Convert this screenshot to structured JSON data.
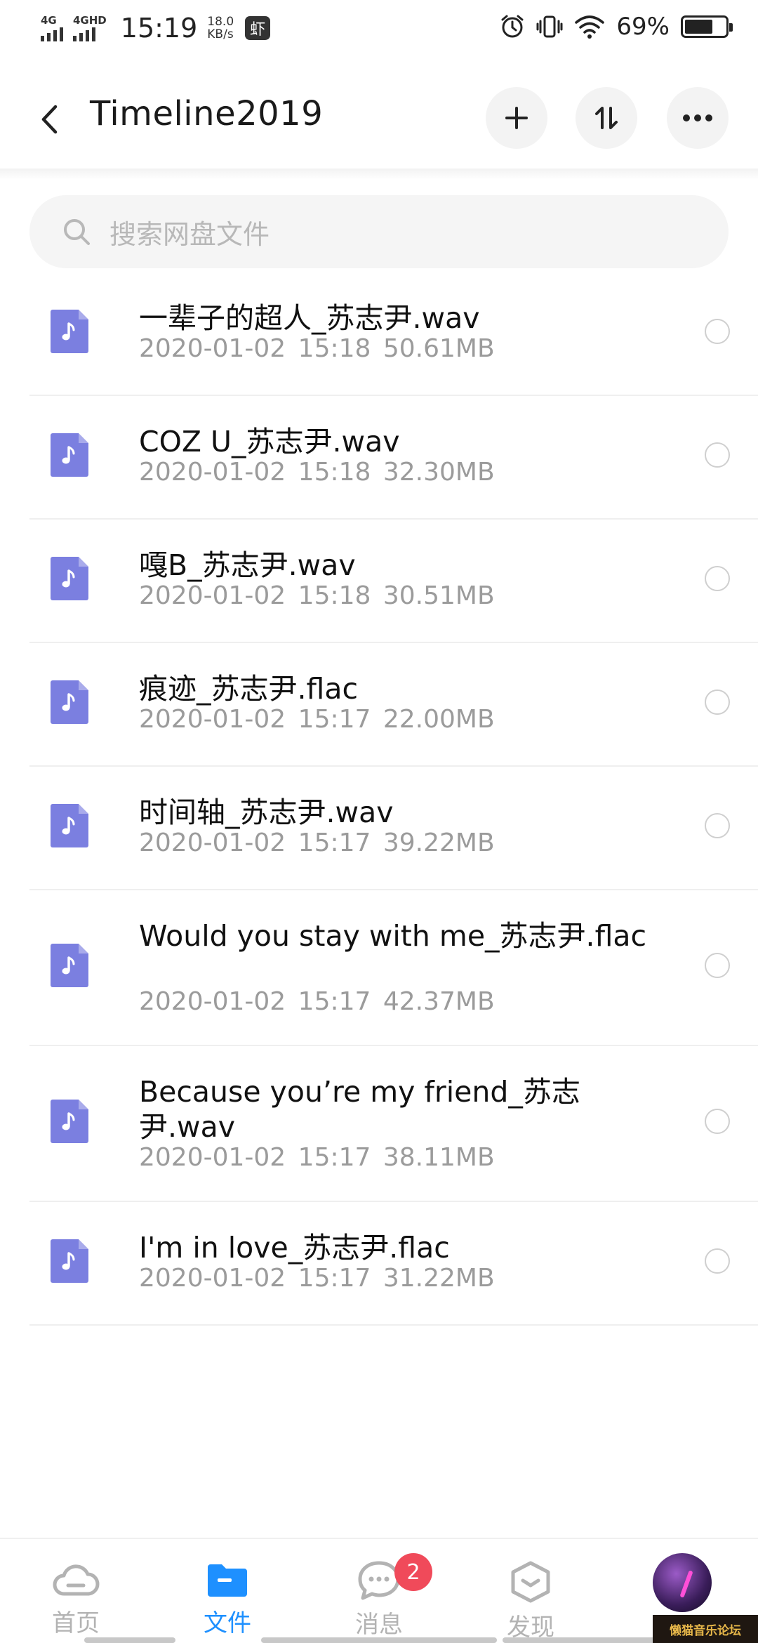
{
  "status_bar": {
    "signal1_label": "4G",
    "signal2_label": "4GHD",
    "time": "15:19",
    "speed_value": "18.0",
    "speed_unit": "KB/s",
    "app_glyph": "虾",
    "battery_percent": "69%",
    "battery_level": 0.69
  },
  "header": {
    "title": "Timeline2019",
    "icons": [
      "back-chevron-icon",
      "plus-icon",
      "sort-icon",
      "more-icon"
    ]
  },
  "search": {
    "placeholder": "搜索网盘文件"
  },
  "files": [
    {
      "name": "一辈子的超人_苏志尹.wav",
      "date": "2020-01-02",
      "time": "15:18",
      "size": "50.61MB"
    },
    {
      "name": "COZ U_苏志尹.wav",
      "date": "2020-01-02",
      "time": "15:18",
      "size": "32.30MB"
    },
    {
      "name": "嘎B_苏志尹.wav",
      "date": "2020-01-02",
      "time": "15:18",
      "size": "30.51MB"
    },
    {
      "name": "痕迹_苏志尹.flac",
      "date": "2020-01-02",
      "time": "15:17",
      "size": "22.00MB"
    },
    {
      "name": "时间轴_苏志尹.wav",
      "date": "2020-01-02",
      "time": "15:17",
      "size": "39.22MB"
    },
    {
      "name": "Would you stay with me_苏志尹.flac",
      "date": "2020-01-02",
      "time": "15:17",
      "size": "42.37MB"
    },
    {
      "name": "Because you’re my friend_苏志尹.wav",
      "date": "2020-01-02",
      "time": "15:17",
      "size": "38.11MB"
    },
    {
      "name": "I'm in love_苏志尹.flac",
      "date": "2020-01-02",
      "time": "15:17",
      "size": "31.22MB"
    }
  ],
  "bottom_nav": {
    "items": [
      {
        "label": "首页",
        "icon": "cloud-icon",
        "active": false
      },
      {
        "label": "文件",
        "icon": "folder-icon",
        "active": true
      },
      {
        "label": "消息",
        "icon": "chat-bubble-icon",
        "active": false,
        "badge": "2"
      },
      {
        "label": "发现",
        "icon": "discover-icon",
        "active": false
      },
      {
        "label": "",
        "icon": "avatar",
        "active": false
      }
    ]
  },
  "watermark": "懒猫音乐论坛",
  "colors": {
    "accent": "#1e90ff",
    "file_icon": "#7b7fe0",
    "badge": "#f04a5a",
    "meta_text": "#9b9b9b"
  }
}
